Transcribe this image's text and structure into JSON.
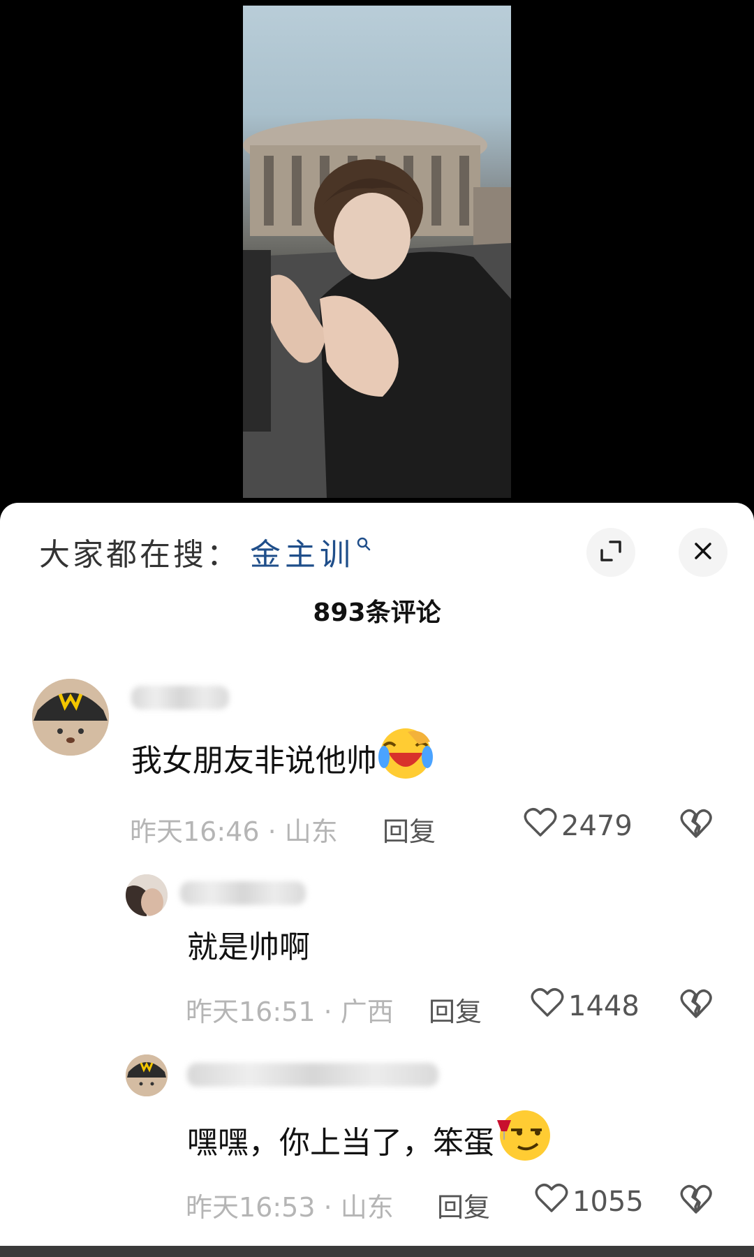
{
  "search": {
    "label": "大家都在搜：",
    "term": "金主训"
  },
  "comments_count": "893条评论",
  "comments": [
    {
      "text": "我女朋友非说他帅",
      "time_location": "昨天16:46 · 山东",
      "reply_label": "回复",
      "likes": "2479",
      "emoji": "laughing-crying-emoji"
    },
    {
      "text": "就是帅啊",
      "time_location": "昨天16:51 · 广西",
      "reply_label": "回复",
      "likes": "1448"
    },
    {
      "text": "嘿嘿，你上当了，笨蛋",
      "time_location": "昨天16:53 · 山东",
      "reply_label": "回复",
      "likes": "1055",
      "emoji": "smirk-wine-emoji"
    }
  ],
  "icons": {
    "expand": "expand-icon",
    "close": "close-icon",
    "like": "heart-icon",
    "dislike": "broken-heart-icon"
  }
}
